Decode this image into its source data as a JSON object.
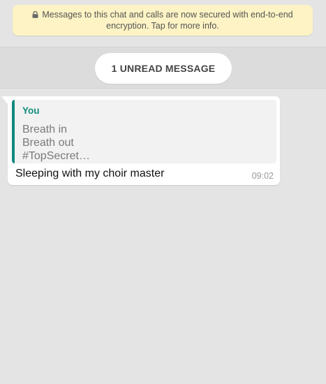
{
  "encryption_notice": {
    "line1": "Messages to this chat and calls are now secured with end-to-end",
    "line2": "encryption. Tap for more info.",
    "icon": "lock-icon",
    "color": "#fdf3c4"
  },
  "unread_banner": {
    "label": "1 UNREAD MESSAGE"
  },
  "message": {
    "quoted": {
      "author": "You",
      "lines": [
        "Breath in",
        "Breath out",
        "#TopSecret…"
      ],
      "accent_color": "#128c7e"
    },
    "text": "Sleeping with my choir master",
    "time": "09:02"
  }
}
